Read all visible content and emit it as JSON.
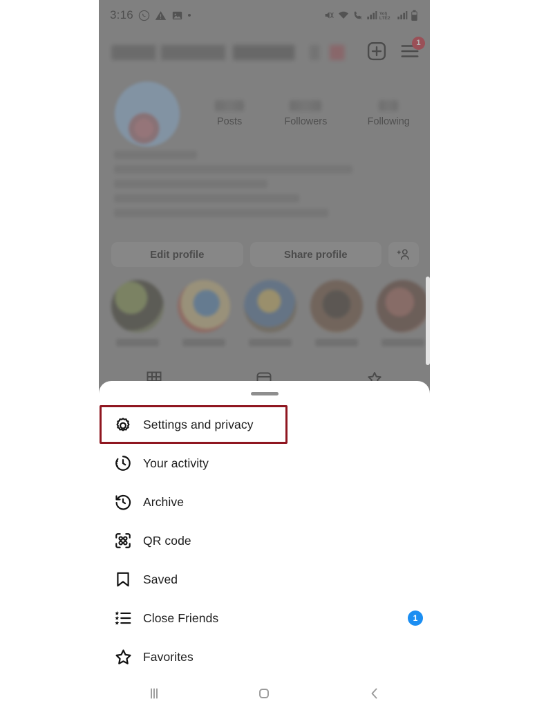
{
  "status_bar": {
    "time": "3:16",
    "left_icons": [
      "whatsapp-icon",
      "warning-icon",
      "photo-icon",
      "dot-icon"
    ],
    "right_icons": [
      "mute-icon",
      "wifi-icon",
      "volte-call-icon",
      "signal-bars-icon",
      "volte2-icon",
      "signal-bars-2-icon",
      "battery-icon"
    ],
    "volte_label": "VoLTE2"
  },
  "profile": {
    "username_redacted": true,
    "add_label": "add-post-icon",
    "menu_label": "hamburger-menu-icon",
    "menu_badge": "1",
    "stats": [
      {
        "label": "Posts",
        "value_redacted": true
      },
      {
        "label": "Followers",
        "value_redacted": true
      },
      {
        "label": "Following",
        "value_redacted": true
      }
    ],
    "buttons": {
      "edit_profile": "Edit profile",
      "share_profile": "Share profile",
      "add_person": "add-person-icon"
    },
    "bio_lines_redacted": 5,
    "highlights_count": 5
  },
  "sheet": {
    "grabber": "drag-handle",
    "items": [
      {
        "label": "Settings and privacy",
        "icon": "gear-icon",
        "badge": "",
        "highlighted": true
      },
      {
        "label": "Your activity",
        "icon": "activity-clock-icon",
        "badge": "",
        "highlighted": false
      },
      {
        "label": "Archive",
        "icon": "archive-clock-icon",
        "badge": "",
        "highlighted": false
      },
      {
        "label": "QR code",
        "icon": "qr-code-icon",
        "badge": "",
        "highlighted": false
      },
      {
        "label": "Saved",
        "icon": "bookmark-icon",
        "badge": "",
        "highlighted": false
      },
      {
        "label": "Close Friends",
        "icon": "close-friends-list-icon",
        "badge": "1",
        "highlighted": false
      },
      {
        "label": "Favorites",
        "icon": "star-icon",
        "badge": "",
        "highlighted": false
      }
    ]
  },
  "nav_bar": {
    "recents": "recents-icon",
    "home": "home-icon",
    "back": "back-icon"
  },
  "colors": {
    "highlight_border": "#8f1620",
    "badge_blue": "#1b8ef2",
    "badge_red": "#c41f30",
    "sheet_bg": "#ffffff",
    "dim_overlay": "#8a8a8a"
  }
}
